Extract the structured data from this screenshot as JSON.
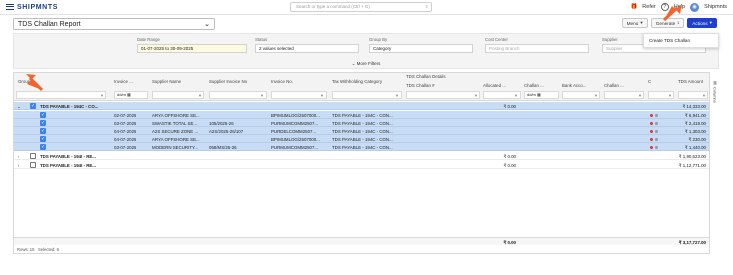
{
  "app": {
    "brand": "SHIPMNTS",
    "search_placeholder": "Search or type a command (Ctrl + G)",
    "refer": "Refer",
    "help": "Help",
    "org": "Shipmnts"
  },
  "report": {
    "title": "TDS Challan Report"
  },
  "toolbar": {
    "menu": "Menu",
    "generate": "Generate",
    "generate_badge": "1",
    "actions": "Actions"
  },
  "actions_menu": {
    "item": "Create TDS Challan"
  },
  "filters": {
    "date_range_label": "Date Range",
    "date_range_value": "01-07-2025 to 30-09-2025",
    "status_label": "Status",
    "status_value": "2 values selected",
    "group_by_label": "Group By",
    "group_by_value": "Category",
    "cost_center_label": "Cost Center",
    "cost_center_placeholder": "Posting Branch",
    "supplier_label": "Supplier",
    "supplier_placeholder": "Supplier",
    "more_filters": "More Filters"
  },
  "grid": {
    "headers": {
      "group": "Group",
      "invoice_date": "Invoice ...",
      "supplier_name": "Supplier Name",
      "supplier_invoice_no": "Supplier Invoice No",
      "invoice_no": "Invoice No.",
      "tds_category": "Tax Withholding Category",
      "tds_details": "TDS Challan Details",
      "tds_challan_no": "TDS Challan #",
      "allocated": "Allocated ...",
      "challan_date": "Challan ...",
      "bank_account": "Bank Acco...",
      "challan_c": "Challan ...",
      "c": "C",
      "tds_amount": "TDS Amount"
    },
    "date_filter_placeholder": "dd/m",
    "rows": [
      {
        "group": "TDS PAYABLE - 194C - CO...",
        "allocated": "₹ 0.00",
        "tds_amount": "₹ 14,333.00"
      },
      {
        "date": "02-07-2025",
        "supplier": "ARYA OFFSHORE SE...",
        "supplier_inv": "",
        "invoice": "BPIMUMLOG/2507000...",
        "category": "TDS PAYABLE - 194C - CON...",
        "amount": "₹ 6,941.00"
      },
      {
        "date": "03-07-2025",
        "supplier": "SWASTIK TOTAL SE...",
        "supplier_inv": "105/2025-26",
        "invoice": "PURMUMCOMM2507...",
        "category": "TDS PAYABLE - 194C - CON...",
        "amount": "₹ 2,419.00"
      },
      {
        "date": "04-07-2025",
        "supplier": "A2S SECURE ZONE ...",
        "supplier_inv": "A2S/2025-26/107",
        "invoice": "PURDELCOMM2507...",
        "category": "TDS PAYABLE - 194C - CON...",
        "amount": "₹ 1,303.00"
      },
      {
        "date": "04-07-2025",
        "supplier": "ARYA OFFSHORE SE...",
        "supplier_inv": "",
        "invoice": "BPIMUMLOG/2507000...",
        "category": "TDS PAYABLE - 194C - CON...",
        "amount": "₹ 230.00"
      },
      {
        "date": "03-07-2025",
        "supplier": "MODERN SECURITY...",
        "supplier_inv": "058/MS/25-26",
        "invoice": "PURMUMCOMM2507...",
        "category": "TDS PAYABLE - 194C - CON...",
        "amount": "₹ 1,440.00"
      },
      {
        "group": "TDS PAYABLE - 194I - RE...",
        "allocated": "₹ 0.00",
        "tds_amount": "₹ 1,90,623.00"
      },
      {
        "group": "TDS PAYABLE - 194I - RE...",
        "allocated": "₹ 0.00",
        "tds_amount": "₹ 1,12,771.00"
      }
    ],
    "totals": {
      "allocated": "₹ 0.00",
      "tds_amount": "₹ 3,17,727.00"
    },
    "status_rows": "Rows: 15",
    "status_selected": "Selected: 6"
  },
  "side_panel": {
    "columns": "Columns"
  },
  "colors": {
    "primary": "#1e3fd1",
    "selected_row": "#c8dcf5",
    "checkbox": "#3b82f6",
    "annotation_arrow": "#f0642d"
  }
}
